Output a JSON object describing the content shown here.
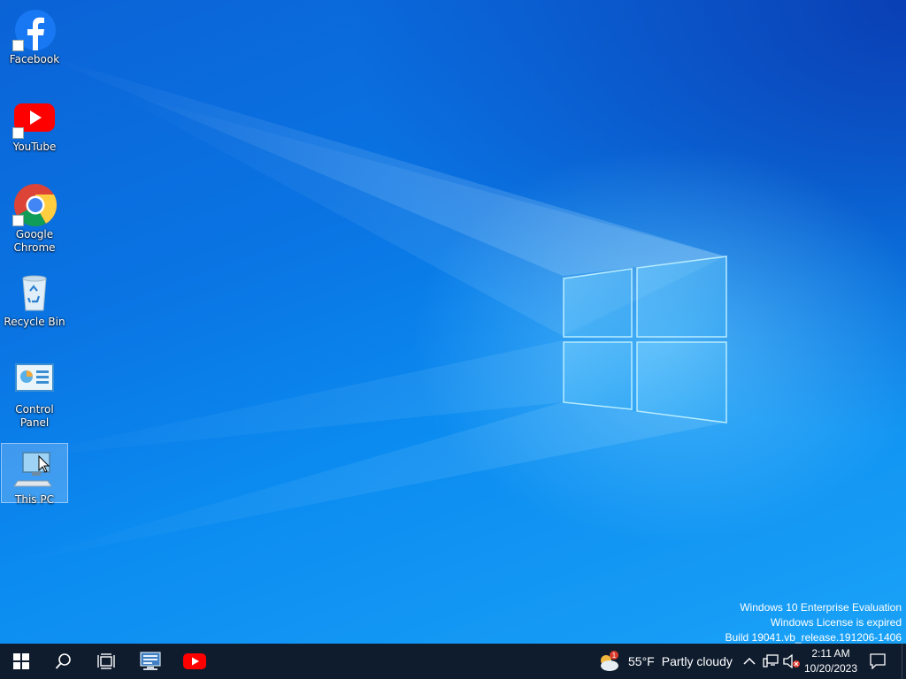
{
  "desktop": {
    "icons": [
      {
        "label": "Facebook",
        "icon": "facebook-icon",
        "shortcut": true
      },
      {
        "label": "YouTube",
        "icon": "youtube-icon",
        "shortcut": true
      },
      {
        "label": "Google Chrome",
        "icon": "chrome-icon",
        "shortcut": true
      },
      {
        "label": "Recycle Bin",
        "icon": "recycle-bin-icon",
        "shortcut": false
      },
      {
        "label": "Control Panel",
        "icon": "control-panel-icon",
        "shortcut": false
      },
      {
        "label": "This PC",
        "icon": "this-pc-icon",
        "shortcut": false,
        "selected": true
      }
    ]
  },
  "watermark": {
    "line1": "Windows 10 Enterprise Evaluation",
    "line2": "Windows License is expired",
    "line3": "Build 19041.vb_release.191206-1406"
  },
  "taskbar": {
    "buttons": [
      "start-icon",
      "search-icon",
      "task-view-icon",
      "network-app-icon",
      "youtube-icon"
    ],
    "weather": {
      "temperature": "55°F",
      "condition": "Partly cloudy",
      "badge": "1"
    },
    "tray": [
      "chevron-up-icon",
      "network-icon",
      "volume-muted-icon",
      "notification-icon"
    ],
    "clock": {
      "time": "2:11 AM",
      "date": "10/20/2023"
    }
  },
  "colors": {
    "taskbar": "#0f1c2e",
    "wallpaper_blue": "#0a74e3",
    "youtube_red": "#ff0000",
    "facebook_blue": "#1877f2"
  }
}
